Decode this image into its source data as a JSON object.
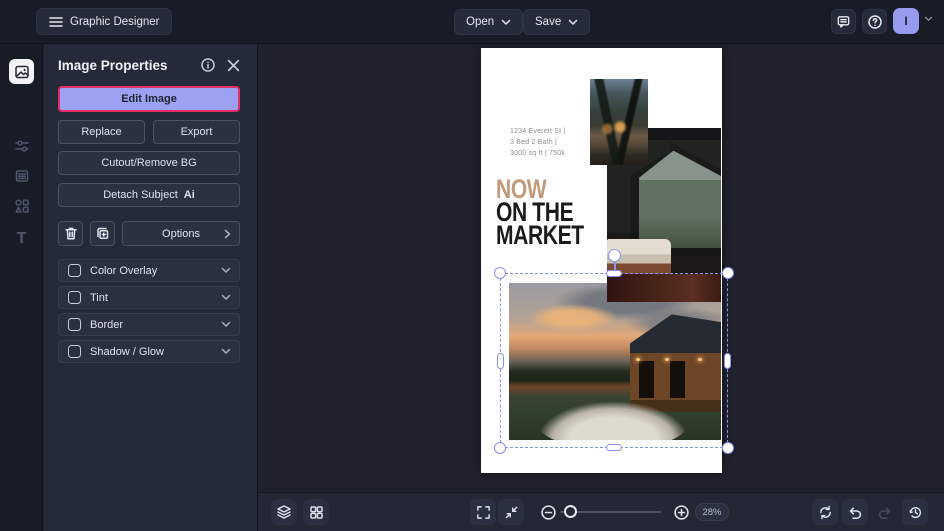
{
  "topbar": {
    "app_title": "Graphic Designer",
    "open": "Open",
    "save": "Save",
    "avatar_initial": "I"
  },
  "sidebar": {
    "items": [
      {
        "name": "images",
        "active": true
      },
      {
        "name": "adjustments",
        "active": false
      },
      {
        "name": "layers-list",
        "active": false
      },
      {
        "name": "elements-shapes",
        "active": false
      },
      {
        "name": "text",
        "active": false,
        "glyph": "T"
      }
    ]
  },
  "panel": {
    "title": "Image Properties",
    "edit_image": "Edit Image",
    "replace": "Replace",
    "export": "Export",
    "cutout": "Cutout/Remove BG",
    "detach": "Detach Subject",
    "detach_badge": "Ai",
    "options": "Options",
    "toggles": [
      {
        "label": "Color Overlay",
        "checked": false
      },
      {
        "label": "Tint",
        "checked": false
      },
      {
        "label": "Border",
        "checked": false
      },
      {
        "label": "Shadow / Glow",
        "checked": false
      }
    ]
  },
  "poster": {
    "address_lines": [
      "1234 Everett St |",
      "3 Bed 2 Bath |",
      "3000 sq ft | 750k"
    ],
    "headline": {
      "accent": "NOW",
      "line2": "ON THE",
      "line3": "MARKET"
    }
  },
  "toolbar": {
    "zoom_value": "28%"
  },
  "colors": {
    "accent_periwinkle": "#969bf0",
    "highlight_pink_border": "#e72d66",
    "selection_blue": "#8a93ea",
    "headline_accent_tan": "#c29a7c",
    "panel_bg": "#242a37",
    "topbar_bg": "#181c27",
    "canvas_bg": "#1f222c"
  },
  "icons": {
    "menu-icon": "hamburger lines",
    "chevron-down-icon": "v chevron",
    "comment-icon": "speech bubble",
    "help-icon": "question mark circle",
    "info-icon": "i in circle",
    "close-icon": "x cross",
    "trash-icon": "trash can",
    "duplicate-icon": "overlapping squares plus",
    "chevron-right-icon": "> chevron",
    "layers-icon": "stacked layers",
    "grid-icon": "2x2 squares",
    "fullscreen-icon": "corner brackets",
    "fit-screen-icon": "inward arrows",
    "zoom-out-icon": "minus circle",
    "zoom-in-icon": "plus circle",
    "reset-icon": "circular sync arrows",
    "undo-icon": "curved arrow left",
    "redo-icon": "curved arrow right",
    "history-icon": "clock with arrow"
  }
}
